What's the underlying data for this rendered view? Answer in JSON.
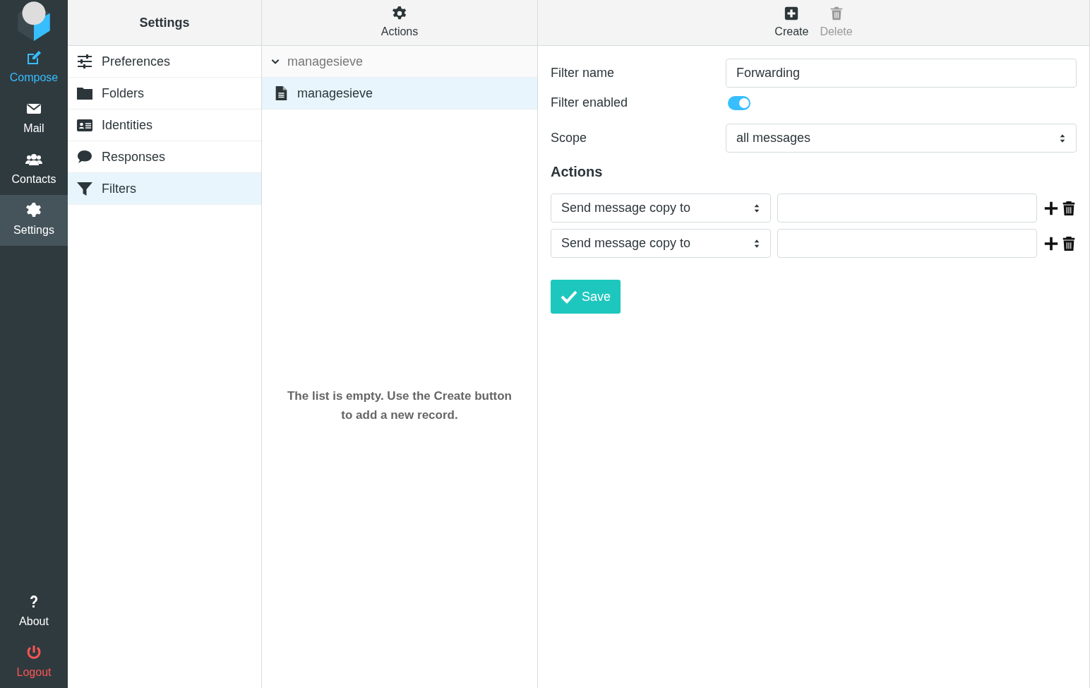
{
  "nav": [
    {
      "label": "Compose",
      "kind": "accent",
      "selected": false
    },
    {
      "label": "Mail",
      "kind": "normal",
      "selected": false
    },
    {
      "label": "Contacts",
      "kind": "normal",
      "selected": false
    },
    {
      "label": "Settings",
      "kind": "normal",
      "selected": true
    }
  ],
  "bottom_nav": [
    {
      "label": "About",
      "kind": "normal"
    },
    {
      "label": "Logout",
      "kind": "danger"
    }
  ],
  "settings_panel": {
    "title": "Settings",
    "items": [
      {
        "label": "Preferences",
        "selected": false
      },
      {
        "label": "Folders",
        "selected": false
      },
      {
        "label": "Identities",
        "selected": false
      },
      {
        "label": "Responses",
        "selected": false
      },
      {
        "label": "Filters",
        "selected": true
      }
    ]
  },
  "list_panel": {
    "toolbar": [
      {
        "label": "Actions",
        "disabled": false
      }
    ],
    "groups": [
      {
        "label": "managesieve",
        "expanded": true,
        "children": [
          {
            "label": "managesieve",
            "selected": true
          }
        ]
      }
    ],
    "empty_message": "The list is empty. Use the Create button to add a new record."
  },
  "form_panel": {
    "toolbar": [
      {
        "label": "Create",
        "disabled": false
      },
      {
        "label": "Delete",
        "disabled": true
      }
    ],
    "fields": [
      {
        "kind": "text",
        "label": "Filter name",
        "value": "Forwarding"
      },
      {
        "kind": "switch",
        "label": "Filter enabled",
        "on": true
      },
      {
        "kind": "select",
        "label": "Scope",
        "value": "all messages"
      }
    ],
    "actions_heading": "Actions",
    "actions": [
      {
        "type": "Send message copy to"
      },
      {
        "type": "Send message copy to"
      }
    ],
    "save_button": "Save"
  }
}
